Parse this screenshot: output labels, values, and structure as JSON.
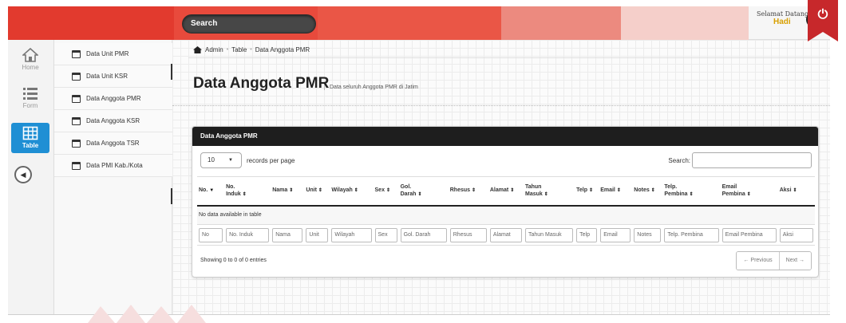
{
  "header": {
    "search_label": "Search",
    "greeting": "Selamat Datang",
    "username": "Hadi",
    "power_glyph": "⏻",
    "power_icon": "power-icon",
    "brand_colors": [
      "#e23a2e",
      "#e84a3c",
      "#ea5646",
      "#ec8a7f",
      "#f5cfca"
    ]
  },
  "rail": {
    "items": [
      {
        "label": "Home",
        "icon": "home-icon"
      },
      {
        "label": "Form",
        "icon": "list-icon"
      },
      {
        "label": "Table",
        "icon": "table-icon",
        "active": true
      }
    ],
    "collapse_glyph": "◀"
  },
  "subnav": {
    "items": [
      {
        "label": "Data Unit PMR"
      },
      {
        "label": "Data Unit KSR"
      },
      {
        "label": "Data Anggota PMR"
      },
      {
        "label": "Data Anggota KSR"
      },
      {
        "label": "Data Anggota TSR"
      },
      {
        "label": "Data PMI Kab./Kota"
      }
    ]
  },
  "breadcrumb": {
    "items": [
      "Admin",
      "Table",
      "Data Anggota PMR"
    ],
    "separator": "•"
  },
  "page": {
    "title": "Data Anggota PMR",
    "subtitle": "Data seluruh Anggota PMR di Jatim"
  },
  "panel": {
    "title": "Data Anggota PMR",
    "length_value": "10",
    "length_suffix": "records per page",
    "search_label": "Search:",
    "empty_text": "No data available in table",
    "info_text": "Showing 0 to 0 of 0 entries",
    "prev_label": "← Previous",
    "next_label": "Next →",
    "columns": [
      {
        "h1": "No.",
        "h2": ""
      },
      {
        "h1": "No.",
        "h2": "Induk"
      },
      {
        "h1": "Nama",
        "h2": ""
      },
      {
        "h1": "Unit",
        "h2": ""
      },
      {
        "h1": "Wilayah",
        "h2": ""
      },
      {
        "h1": "Sex",
        "h2": ""
      },
      {
        "h1": "Gol.",
        "h2": "Darah"
      },
      {
        "h1": "Rhesus",
        "h2": ""
      },
      {
        "h1": "Alamat",
        "h2": ""
      },
      {
        "h1": "Tahun",
        "h2": "Masuk"
      },
      {
        "h1": "Telp",
        "h2": ""
      },
      {
        "h1": "Email",
        "h2": ""
      },
      {
        "h1": "Notes",
        "h2": ""
      },
      {
        "h1": "Telp.",
        "h2": "Pembina"
      },
      {
        "h1": "Email",
        "h2": "Pembina"
      },
      {
        "h1": "Aksi",
        "h2": ""
      }
    ],
    "filters": [
      "No",
      "No. Induk",
      "Nama",
      "Unit",
      "Wilayah",
      "Sex",
      "Gol. Darah",
      "Rhesus",
      "Alamat",
      "Tahun Masuk",
      "Telp",
      "Email",
      "Notes",
      "Telp. Pembina",
      "Email Pembina",
      "Aksi"
    ]
  }
}
